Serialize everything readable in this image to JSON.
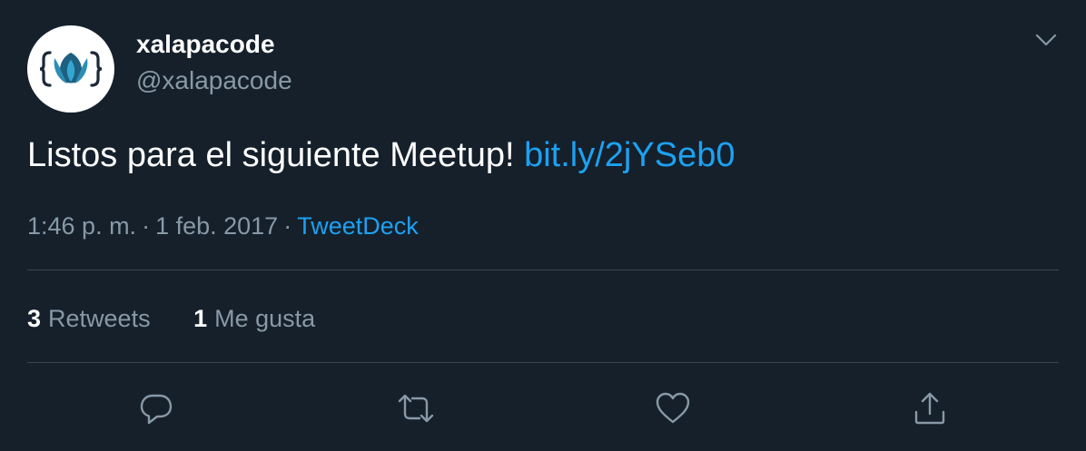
{
  "user": {
    "display_name": "xalapacode",
    "handle": "@xalapacode",
    "avatar_icon": "xalapacode-logo"
  },
  "tweet": {
    "text": "Listos para el siguiente Meetup! ",
    "link": "bit.ly/2jYSeb0"
  },
  "meta": {
    "time": "1:46 p. m.",
    "separator": "·",
    "date": "1 feb. 2017",
    "source": "TweetDeck"
  },
  "stats": {
    "retweets_count": "3",
    "retweets_label": "Retweets",
    "likes_count": "1",
    "likes_label": "Me gusta"
  },
  "actions": [
    {
      "icon": "reply-icon"
    },
    {
      "icon": "retweet-icon"
    },
    {
      "icon": "like-icon"
    },
    {
      "icon": "share-icon"
    }
  ],
  "colors": {
    "background": "#15202b",
    "link": "#1da1f2",
    "secondary_text": "#8899a6",
    "divider": "#38444d"
  }
}
